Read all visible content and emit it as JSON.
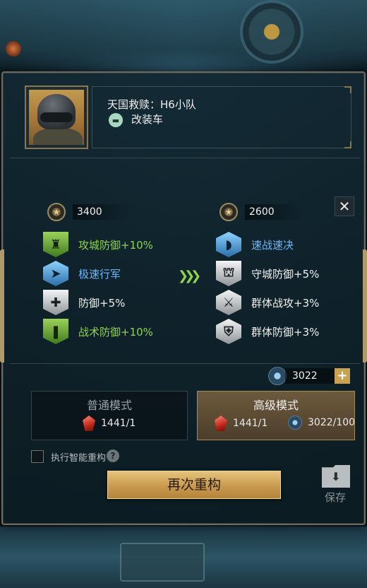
{
  "unit": {
    "name": "天国救赎：H6小队",
    "vehicle_type": "改装车"
  },
  "current": {
    "score": "3400",
    "traits": [
      {
        "label": "攻城防御+10%",
        "color": "green",
        "icon": "castle-shield-icon"
      },
      {
        "label": "极速行军",
        "color": "blue",
        "icon": "runner-icon"
      },
      {
        "label": "防御+5%",
        "color": "white",
        "icon": "plus-shield-icon"
      },
      {
        "label": "战术防御+10%",
        "color": "green",
        "icon": "tactic-shield-icon"
      }
    ]
  },
  "new": {
    "score": "2600",
    "traits": [
      {
        "label": "速战速决",
        "color": "blue",
        "icon": "bullet-icon"
      },
      {
        "label": "守城防御+5%",
        "color": "white",
        "icon": "gate-icon"
      },
      {
        "label": "群体战攻+3%",
        "color": "white",
        "icon": "group-attack-icon"
      },
      {
        "label": "群体防御+3%",
        "color": "white",
        "icon": "group-defense-icon"
      }
    ]
  },
  "resource": {
    "amount": "3022",
    "plus_label": "+"
  },
  "modes": {
    "normal": {
      "title": "普通模式",
      "ruby_cost": "1441/1"
    },
    "advanced": {
      "title": "高级模式",
      "ruby_cost": "1441/1",
      "part_cost": "3022/100"
    }
  },
  "smart_rebuild_label": "执行智能重构",
  "help_label": "?",
  "rebuild_button": "再次重构",
  "save_label": "保存",
  "close_label": "✕"
}
